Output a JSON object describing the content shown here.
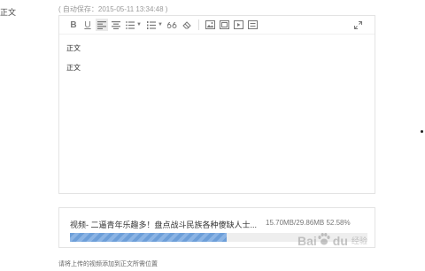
{
  "sidebar": {
    "label": "正文"
  },
  "editor": {
    "autosave_text": "( 自动保存：2015-05-11 13:34:48 )",
    "toolbar": {
      "bold": "B",
      "underline": "U"
    },
    "content": {
      "line1": "正文",
      "line2": "正文"
    }
  },
  "upload": {
    "title": "视频- 二逼青年乐趣多！盘点战斗民族各种傻缺人士...",
    "stats": "15.70MB/29.86MB 52.58%",
    "progress_fraction": 0.5258,
    "bar_color": "#6d9fd9"
  },
  "hint": "请将上传的视频添加到正文所需位置",
  "watermark": {
    "main": "Bai",
    "paw_char": "du",
    "sub": "经验"
  }
}
